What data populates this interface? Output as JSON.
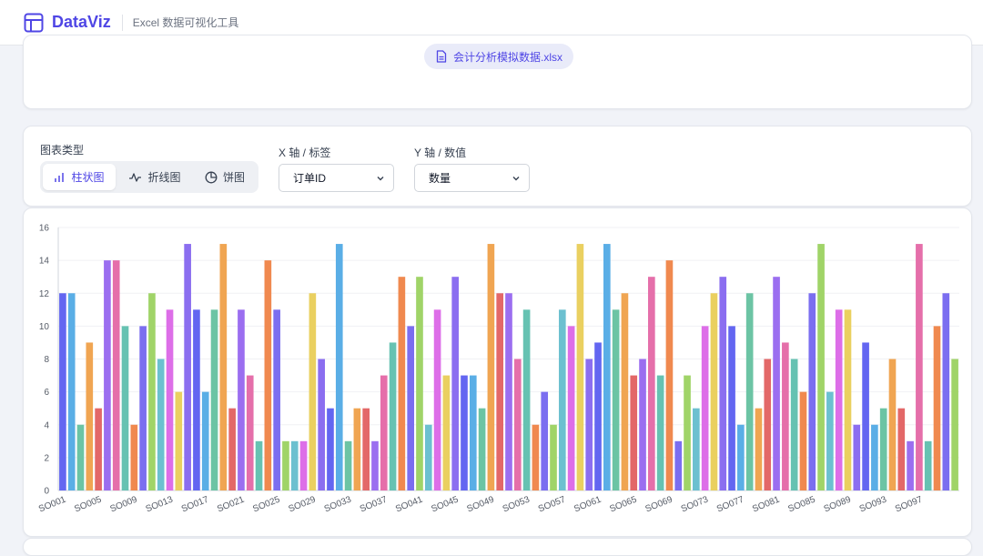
{
  "header": {
    "app_name": "DataViz",
    "subtitle": "Excel 数据可视化工具",
    "brand_color": "#4f46e5"
  },
  "file": {
    "name": "会计分析模拟数据.xlsx",
    "icon": "document-icon"
  },
  "controls": {
    "chart_type_label": "图表类型",
    "chart_types": [
      {
        "label": "柱状图",
        "icon": "bar-chart-icon",
        "active": true
      },
      {
        "label": "折线图",
        "icon": "line-chart-icon",
        "active": false
      },
      {
        "label": "饼图",
        "icon": "pie-chart-icon",
        "active": false
      }
    ],
    "x_axis_label": "X 轴 / 标签",
    "x_axis_value": "订单ID",
    "y_axis_label": "Y 轴 / 数值",
    "y_axis_value": "数量"
  },
  "chart_data": {
    "type": "bar",
    "ylim": [
      0,
      16
    ],
    "yticks": [
      0,
      2,
      4,
      6,
      8,
      10,
      12,
      14,
      16
    ],
    "grid": true,
    "categories": [
      "SO001",
      "SO002",
      "SO003",
      "SO004",
      "SO005",
      "SO006",
      "SO007",
      "SO008",
      "SO009",
      "SO010",
      "SO011",
      "SO012",
      "SO013",
      "SO014",
      "SO015",
      "SO016",
      "SO017",
      "SO018",
      "SO019",
      "SO020",
      "SO021",
      "SO022",
      "SO023",
      "SO024",
      "SO025",
      "SO026",
      "SO027",
      "SO028",
      "SO029",
      "SO030",
      "SO031",
      "SO032",
      "SO033",
      "SO034",
      "SO035",
      "SO036",
      "SO037",
      "SO038",
      "SO039",
      "SO040",
      "SO041",
      "SO042",
      "SO043",
      "SO044",
      "SO045",
      "SO046",
      "SO047",
      "SO048",
      "SO049",
      "SO050",
      "SO051",
      "SO052",
      "SO053",
      "SO054",
      "SO055",
      "SO056",
      "SO057",
      "SO058",
      "SO059",
      "SO060",
      "SO061",
      "SO062",
      "SO063",
      "SO064",
      "SO065",
      "SO066",
      "SO067",
      "SO068",
      "SO069",
      "SO070",
      "SO071",
      "SO072",
      "SO073",
      "SO074",
      "SO075",
      "SO076",
      "SO077",
      "SO078",
      "SO079",
      "SO080",
      "SO081",
      "SO082",
      "SO083",
      "SO084",
      "SO085",
      "SO086",
      "SO087",
      "SO088",
      "SO089",
      "SO090",
      "SO091",
      "SO092",
      "SO093",
      "SO094",
      "SO095",
      "SO096",
      "SO097",
      "SO098",
      "SO099",
      "SO100"
    ],
    "visible_tick_labels": [
      "SO001",
      "SO005",
      "SO009",
      "SO013",
      "SO017",
      "SO021",
      "SO025",
      "SO029",
      "SO033",
      "SO037",
      "SO041",
      "SO045",
      "SO049",
      "SO053",
      "SO057",
      "SO061",
      "SO065",
      "SO069",
      "SO073",
      "SO077",
      "SO081",
      "SO085",
      "SO089",
      "SO093",
      "SO097"
    ],
    "values": [
      12,
      12,
      4,
      9,
      5,
      14,
      14,
      10,
      4,
      10,
      12,
      8,
      11,
      6,
      15,
      11,
      6,
      11,
      15,
      5,
      11,
      7,
      3,
      14,
      11,
      3,
      3,
      3,
      12,
      8,
      5,
      15,
      3,
      5,
      5,
      3,
      7,
      9,
      13,
      10,
      13,
      4,
      11,
      7,
      13,
      7,
      7,
      5,
      15,
      12,
      12,
      8,
      11,
      4,
      6,
      4,
      11,
      10,
      15,
      8,
      9,
      15,
      11,
      12,
      7,
      8,
      13,
      7,
      14,
      3,
      7,
      5,
      10,
      12,
      13,
      10,
      4,
      12,
      5,
      8,
      13,
      9,
      8,
      6,
      12,
      15,
      6,
      11,
      11,
      4,
      9,
      4,
      5,
      8,
      5,
      3,
      15,
      3,
      10,
      12,
      8
    ],
    "colors": [
      "#6366f1",
      "#5aaee6",
      "#6cc4a4",
      "#f0a552",
      "#e36868",
      "#9b6ef0",
      "#e56faa",
      "#66c2b2",
      "#f0894f",
      "#7b6ef0",
      "#a0d468",
      "#6cc0d0",
      "#dd6ee8",
      "#ead060",
      "#8b6ef0"
    ]
  }
}
